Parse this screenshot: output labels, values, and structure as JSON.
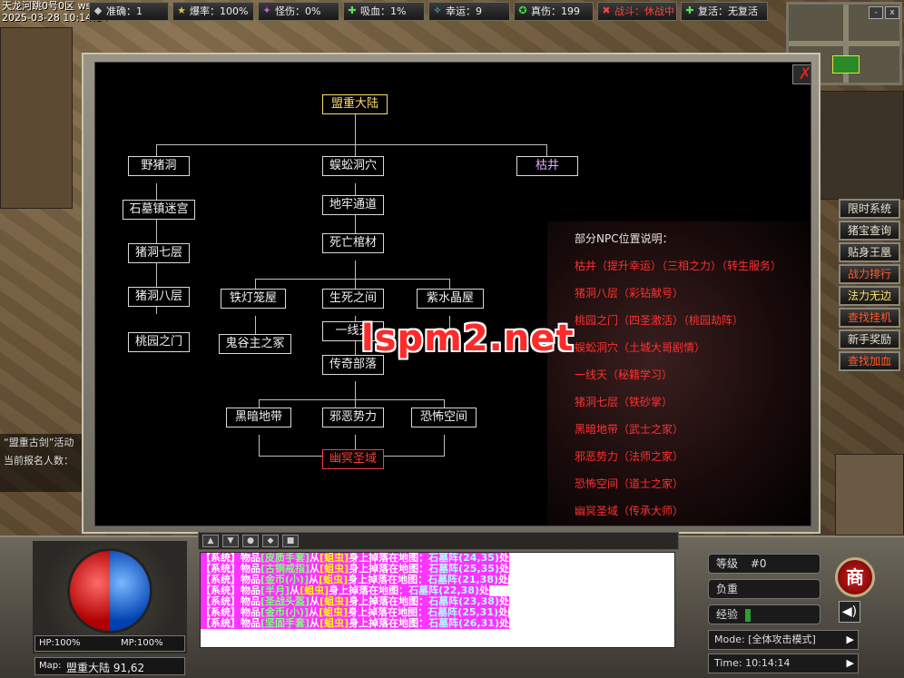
{
  "server_info": {
    "line1": "天龙河跳0号0区",
    "version": "ws521",
    "line2": "2025-03-28 10:14:14"
  },
  "top_stats": [
    {
      "label": "准确：1",
      "color": "#c8c8c8",
      "icon": "accuracy-icon"
    },
    {
      "label": "爆率：100%",
      "color": "#c8c8c8",
      "icon": "drop-rate-icon"
    },
    {
      "label": "怪伤：0%",
      "color": "#c8c8c8",
      "icon": "monster-damage-icon"
    },
    {
      "label": "吸血：1%",
      "color": "#c8c8c8",
      "icon": "lifesteal-icon"
    },
    {
      "label": "幸运：9",
      "color": "#c8c8c8",
      "icon": "luck-icon"
    },
    {
      "label": "真伤：199",
      "color": "#c8c8c8",
      "icon": "true-damage-icon"
    },
    {
      "label": "战斗：休战中",
      "color": "#ff4040",
      "icon": "battle-icon"
    },
    {
      "label": "复活：无复活",
      "color": "#c8c8c8",
      "icon": "revive-icon"
    }
  ],
  "minimap": {
    "buttons": [
      "-",
      "x"
    ]
  },
  "side_menu": [
    {
      "label": "限时系统",
      "style": "normal"
    },
    {
      "label": "猪宝查询",
      "style": "normal"
    },
    {
      "label": "贴身王凰",
      "style": "normal"
    },
    {
      "label": "战力排行",
      "style": "red"
    },
    {
      "label": "法力无边",
      "style": "yellow"
    },
    {
      "label": "查找挂机",
      "style": "red"
    },
    {
      "label": "新手奖励",
      "style": "normal"
    },
    {
      "label": "查找加血",
      "style": "red"
    }
  ],
  "left_misc": {
    "event": "“盟重古剑”活动",
    "signup": "当前报名人数："
  },
  "map_tree": {
    "root": "盟重大陆",
    "left_chain": [
      "野猪洞",
      "石墓镇迷宫",
      "猪洞七层",
      "猪洞八层",
      "桃园之门"
    ],
    "center_chain": [
      "蜈蚣洞穴",
      "地牢通道",
      "死亡棺材"
    ],
    "right": "枯井",
    "tier3": [
      "铁灯笼屋",
      "生死之间",
      "紫水晶屋"
    ],
    "tier3_sub_left": "鬼谷主之冢",
    "tier3_sub_mid": "一线天",
    "mid2": "传奇部落",
    "tier4": [
      "黑暗地带",
      "邪恶势力",
      "恐怖空间"
    ],
    "final": "幽冥圣域"
  },
  "npc_panel": {
    "title": "部分NPC位置说明：",
    "lines": [
      "枯井（提升幸运）（三相之力）（转生服务）",
      "猪洞八层（彩钻献号）",
      "桃园之门（四圣激活）（桃园劫阵）",
      "蜈蚣洞穴（土城大哥剧情）",
      "一线天（秘籍学习）",
      "猪洞七层（铁砂掌）",
      "黑暗地带（武士之家）",
      "邪恶势力（法师之家）",
      "恐怖空间（道士之家）",
      "幽冥圣域（传承大师）"
    ]
  },
  "watermark": "lspm2.net",
  "chat": {
    "tabs": [
      "▲",
      "▼",
      "●",
      "◆",
      "■"
    ],
    "lines": [
      {
        "sys": "【系统】",
        "w1": "物品",
        "item": "[皮质手套]",
        "w2": "从",
        "mob": "[蛆虫]",
        "w3": "身上掉落在地图：",
        "map": "石墓阵(24,35)",
        "end": "处"
      },
      {
        "sys": "【系统】",
        "w1": "物品",
        "item": "[古铜戒指]",
        "w2": "从",
        "mob": "[蛆虫]",
        "w3": "身上掉落在地图：",
        "map": "石墓阵(25,35)",
        "end": "处"
      },
      {
        "sys": "【系统】",
        "w1": "物品",
        "item": "[金币(小)]",
        "w2": "从",
        "mob": "[蛆虫]",
        "w3": "身上掉落在地图：",
        "map": "石墓阵(21,38)",
        "end": "处"
      },
      {
        "sys": "【系统】",
        "w1": "物品",
        "item": "[半月]",
        "w2": "从",
        "mob": "[蛆虫]",
        "w3": "身上掉落在地图：",
        "map": "石墓阵(22,38)",
        "end": "处"
      },
      {
        "sys": "【系统】",
        "w1": "物品",
        "item": "[圣战头盔]",
        "w2": "从",
        "mob": "[蛆虫]",
        "w3": "身上掉落在地图：",
        "map": "石墓阵(23,38)",
        "end": "处"
      },
      {
        "sys": "【系统】",
        "w1": "物品",
        "item": "[金币(小)]",
        "w2": "从",
        "mob": "[蛆虫]",
        "w3": "身上掉落在地图：",
        "map": "石墓阵(25,31)",
        "end": "处"
      },
      {
        "sys": "【系统】",
        "w1": "物品",
        "item": "[坚固手套]",
        "w2": "从",
        "mob": "[蛆虫]",
        "w3": "身上掉落在地图：",
        "map": "石墓阵(26,31)",
        "end": "处"
      }
    ]
  },
  "hud": {
    "hp_label": "HP:100%",
    "mp_label": "MP:100%",
    "map_label": "Map:",
    "map_name": "盟重大陆 91,62",
    "level_label": "等级",
    "level_value": "#0",
    "weight_label": "负重",
    "exp_label": "经验",
    "mode_label": "Mode:",
    "mode_value": "[全体攻击模式]",
    "time_label": "Time:",
    "time_value": "10:14:14",
    "shop_label": "商",
    "hp_fill": 1.0,
    "mp_fill": 1.0,
    "exp_fill": 0.08
  }
}
